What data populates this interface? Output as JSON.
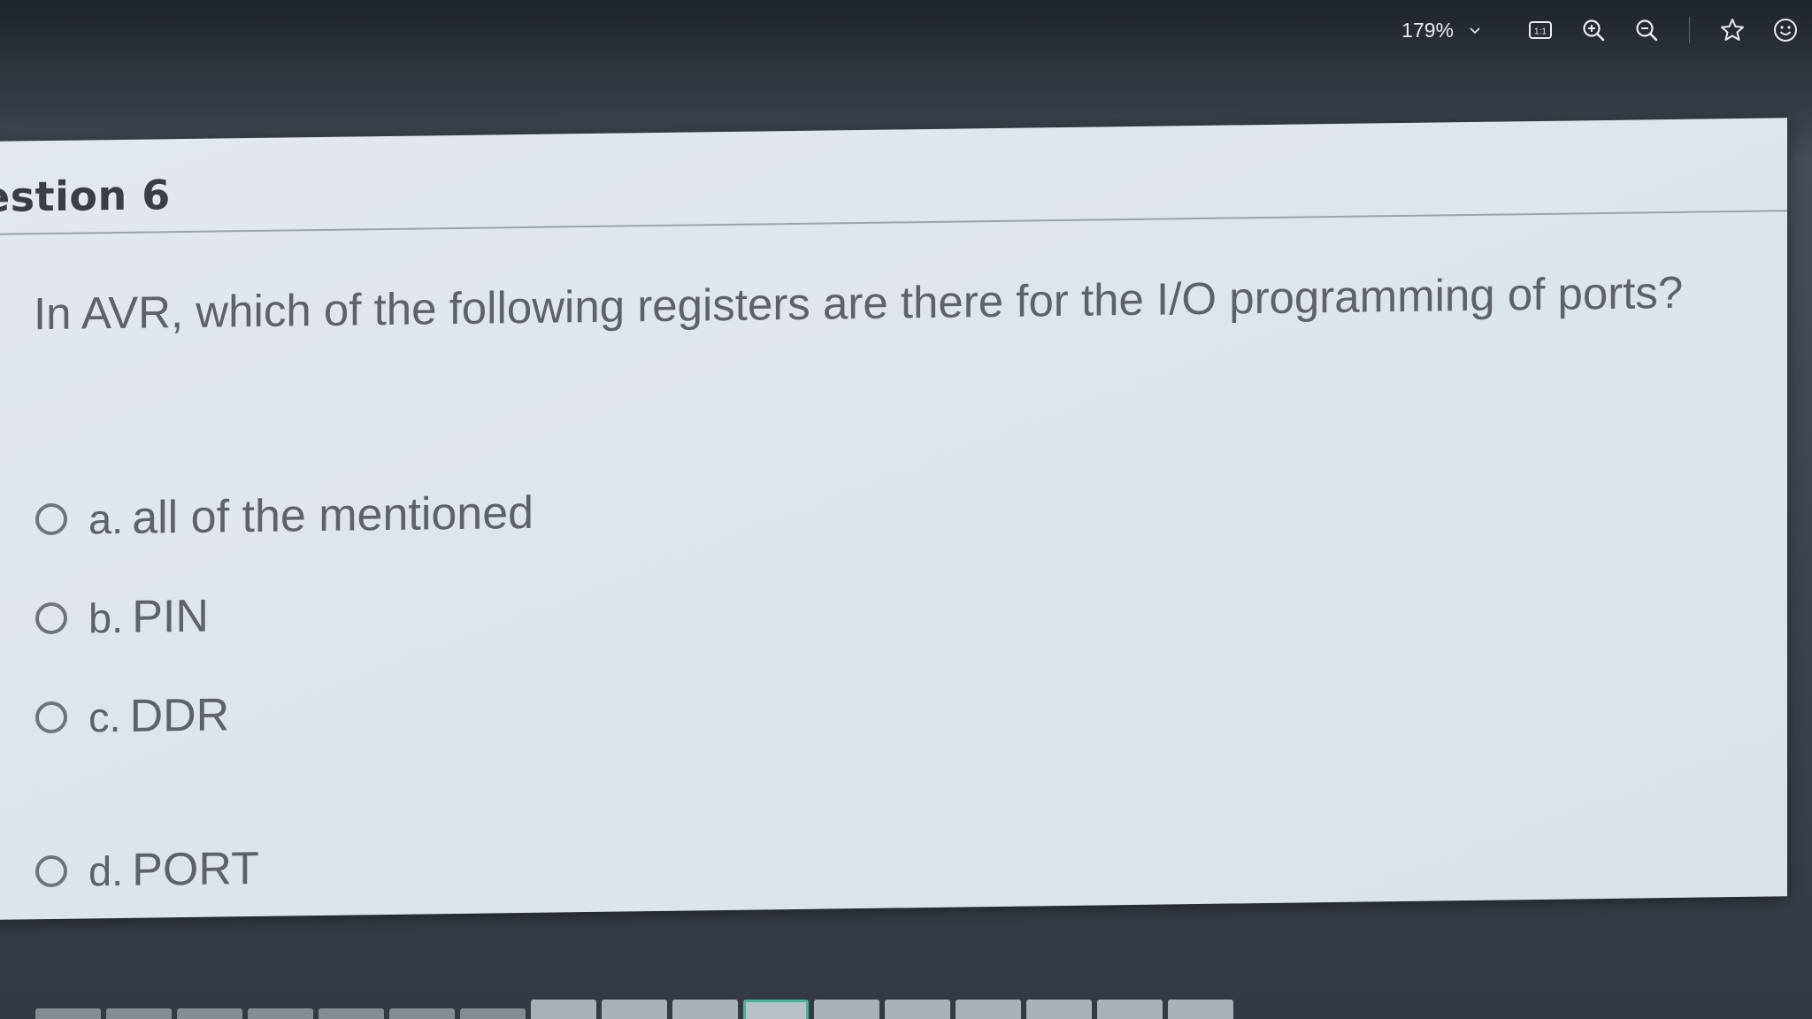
{
  "toolbar": {
    "zoom_label": "179%",
    "icons": [
      "chevron-down-icon",
      "actual-size-icon",
      "zoom-in-icon",
      "zoom-out-icon",
      "star-icon",
      "smiley-icon"
    ],
    "actual_size_label": "1:1"
  },
  "question": {
    "title": "estion 6",
    "text": "In AVR, which of the following registers are there for the I/O programming of ports?",
    "options": [
      {
        "letter": "a.",
        "text": "all of the mentioned"
      },
      {
        "letter": "b.",
        "text": "PIN"
      },
      {
        "letter": "c.",
        "text": "DDR"
      },
      {
        "letter": "d.",
        "text": "PORT"
      }
    ]
  },
  "colors": {
    "page_background": "#e0e6ed",
    "text": "#5e6168",
    "toolbar_text": "#e9ecf0",
    "active_thumb": "#4fbfa3"
  }
}
